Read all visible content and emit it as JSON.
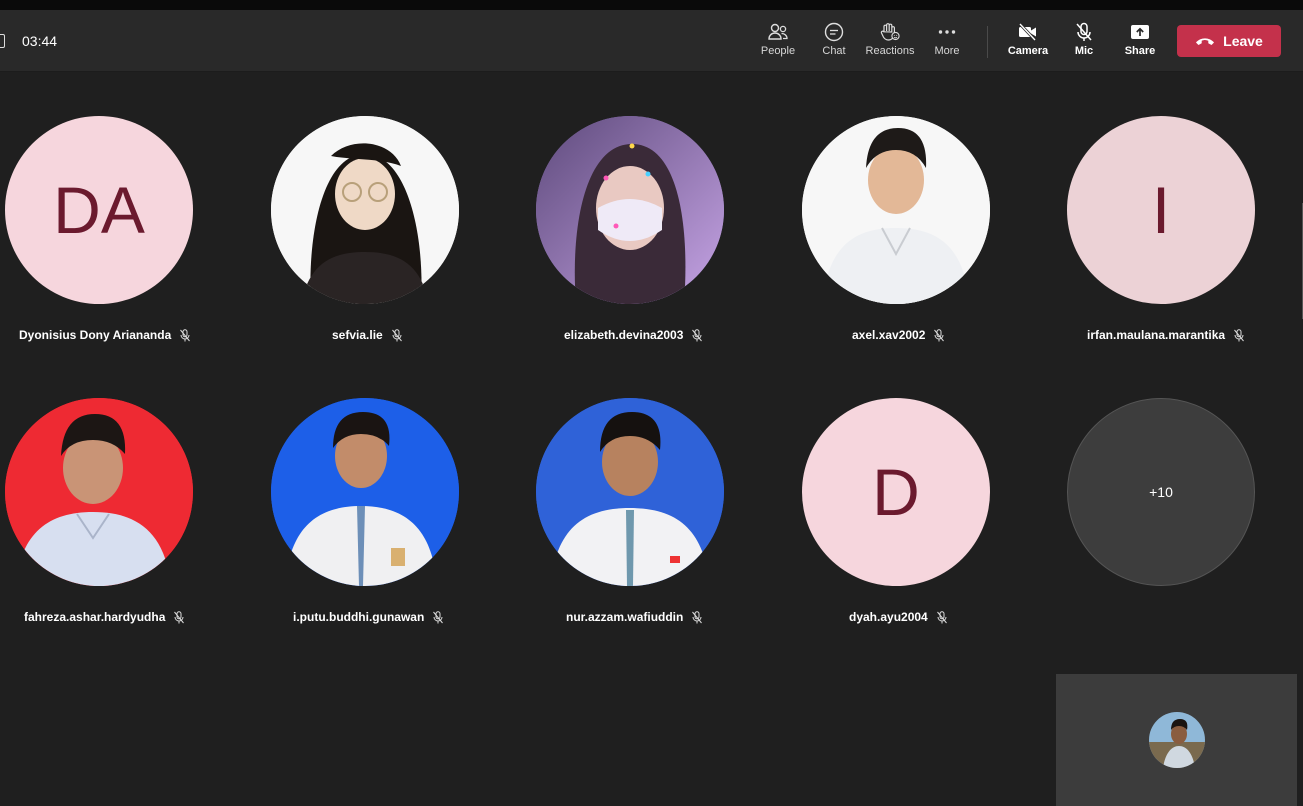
{
  "meeting": {
    "timer": "03:44"
  },
  "toolbar": {
    "people": "People",
    "chat": "Chat",
    "reactions": "Reactions",
    "more": "More",
    "camera": "Camera",
    "mic": "Mic",
    "share": "Share",
    "leave": "Leave"
  },
  "participants": [
    {
      "name": "Dyonisius Dony Ariananda",
      "initials": "DA",
      "muted": true
    },
    {
      "name": "sefvia.lie",
      "muted": true
    },
    {
      "name": "elizabeth.devina2003",
      "muted": true
    },
    {
      "name": "axel.xav2002",
      "muted": true
    },
    {
      "name": "irfan.maulana.marantika",
      "initials": "I",
      "muted": true
    },
    {
      "name": "fahreza.ashar.hardyudha",
      "muted": true
    },
    {
      "name": "i.putu.buddhi.gunawan",
      "muted": true
    },
    {
      "name": "nur.azzam.wafiuddin",
      "muted": true
    },
    {
      "name": "dyah.ayu2004",
      "initials": "D",
      "muted": true
    }
  ],
  "overflow": {
    "label": "+10"
  },
  "colors": {
    "leave": "#c4314b",
    "initials_bg": "#f6d6dd",
    "initials_fg": "#6b1a2e"
  }
}
